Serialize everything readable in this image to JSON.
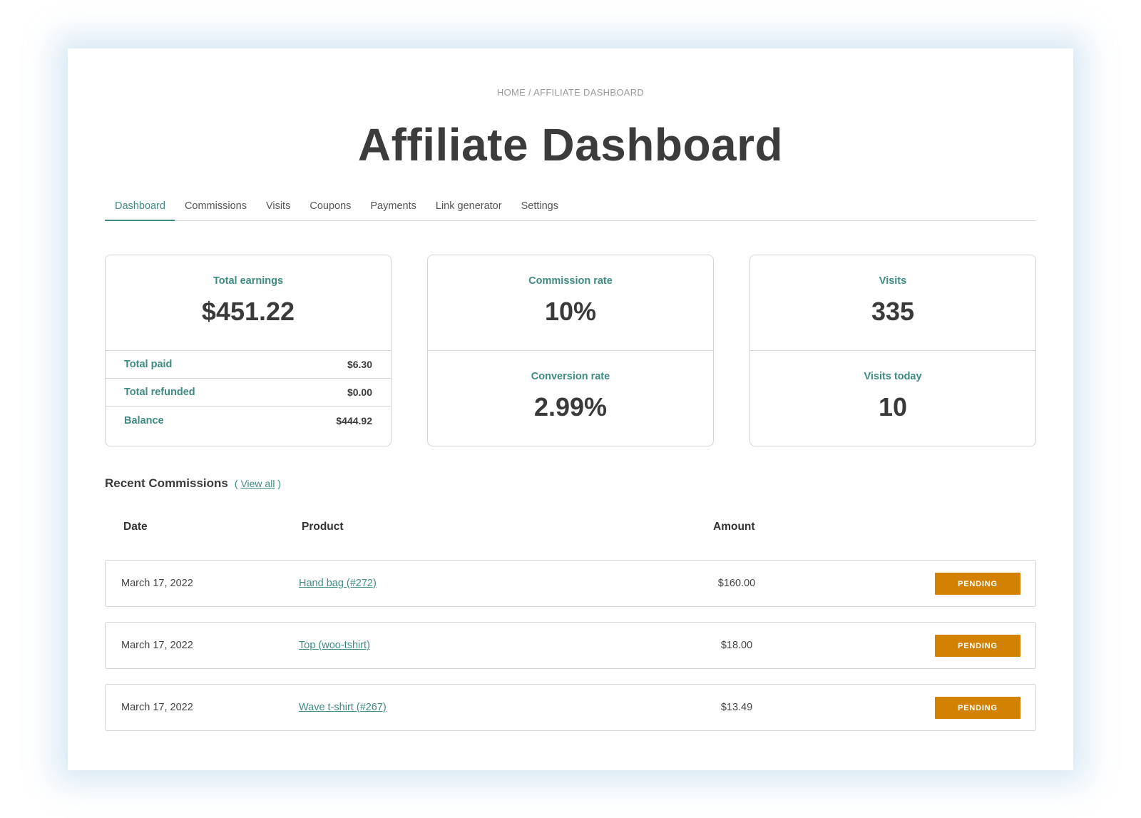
{
  "breadcrumb": "HOME / AFFILIATE DASHBOARD",
  "page_title": "Affiliate Dashboard",
  "tabs": [
    {
      "label": "Dashboard",
      "active": true
    },
    {
      "label": "Commissions",
      "active": false
    },
    {
      "label": "Visits",
      "active": false
    },
    {
      "label": "Coupons",
      "active": false
    },
    {
      "label": "Payments",
      "active": false
    },
    {
      "label": "Link generator",
      "active": false
    },
    {
      "label": "Settings",
      "active": false
    }
  ],
  "earnings_card": {
    "label": "Total earnings",
    "value": "$451.22",
    "rows": [
      {
        "label": "Total paid",
        "value": "$6.30"
      },
      {
        "label": "Total refunded",
        "value": "$0.00"
      },
      {
        "label": "Balance",
        "value": "$444.92"
      }
    ]
  },
  "rates_card": {
    "top": {
      "label": "Commission rate",
      "value": "10%"
    },
    "bottom": {
      "label": "Conversion rate",
      "value": "2.99%"
    }
  },
  "visits_card": {
    "top": {
      "label": "Visits",
      "value": "335"
    },
    "bottom": {
      "label": "Visits today",
      "value": "10"
    }
  },
  "recent_commissions": {
    "title": "Recent Commissions",
    "view_all_open": "(",
    "view_all_label": "View all",
    "view_all_close": ")",
    "columns": [
      "Date",
      "Product",
      "Amount",
      ""
    ],
    "rows": [
      {
        "date": "March 17, 2022",
        "product": "Hand bag (#272)",
        "amount": "$160.00",
        "status": "PENDING"
      },
      {
        "date": "March 17, 2022",
        "product": "Top (woo-tshirt)",
        "amount": "$18.00",
        "status": "PENDING"
      },
      {
        "date": "March 17, 2022",
        "product": "Wave t-shirt (#267)",
        "amount": "$13.49",
        "status": "PENDING"
      }
    ]
  },
  "colors": {
    "accent": "#3d8b83",
    "pending_badge": "#d38100",
    "text": "#3a3a3a"
  }
}
